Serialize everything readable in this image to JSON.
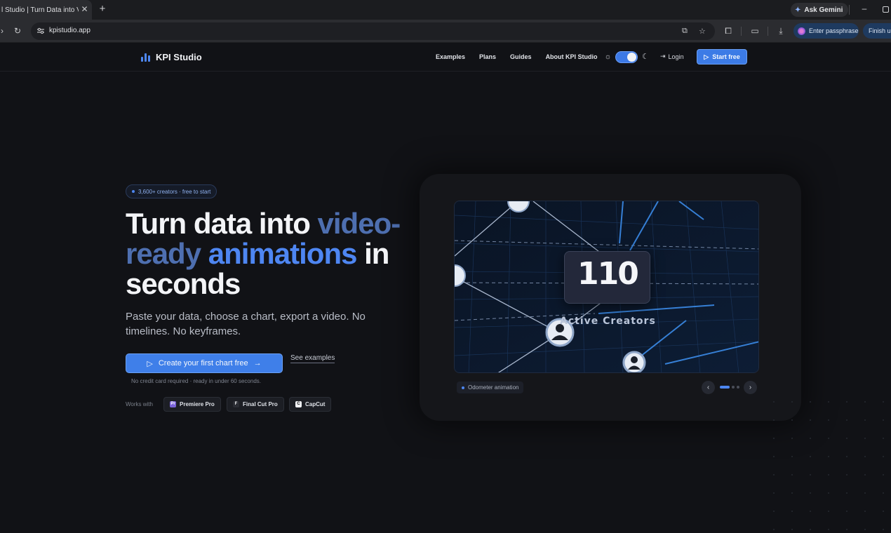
{
  "browser": {
    "tab_title": "l Studio | Turn Data into Vide",
    "tab_close": "✕",
    "new_tab": "+",
    "ask_gemini": "Ask Gemini",
    "url": "kpistudio.app",
    "passphrase_label": "Enter passphrase",
    "finish_label": "Finish up"
  },
  "header": {
    "brand": "KPI Studio",
    "nav": [
      "Examples",
      "Plans",
      "Guides",
      "About KPI Studio"
    ],
    "login": "Login",
    "start_free": "Start free",
    "theme_toggle_on": true
  },
  "hero": {
    "badge": "3,600+ creators · free to start",
    "headline": {
      "part1": "Turn data into ",
      "accent1": "video-",
      "accent2_dim": "ready",
      "space": " ",
      "accent3": "animations",
      "part2": " in",
      "part3": "seconds"
    },
    "subtitle": "Paste your data, choose a chart, export a video. No timelines. No keyframes.",
    "cta": "Create your first chart free",
    "see_examples": "See examples",
    "note": "No credit card required · ready in under 60 seconds.",
    "works_with_label": "Works with",
    "tools": [
      {
        "name": "Premiere Pro",
        "icon": "Pr",
        "color": "#7a63d9"
      },
      {
        "name": "Final Cut Pro",
        "icon": "F",
        "color": "#2a2c33"
      },
      {
        "name": "CapCut",
        "icon": "C",
        "color": "#f1f2f5"
      }
    ]
  },
  "preview": {
    "odometer_digits": "110",
    "caption": "Active Creators",
    "animation_label": "Odometer animation",
    "carousel_active_index": 0,
    "carousel_count": 3
  },
  "colors": {
    "accent": "#4e86f2",
    "accent_dim": "#4e6fb0",
    "background": "#111216"
  }
}
